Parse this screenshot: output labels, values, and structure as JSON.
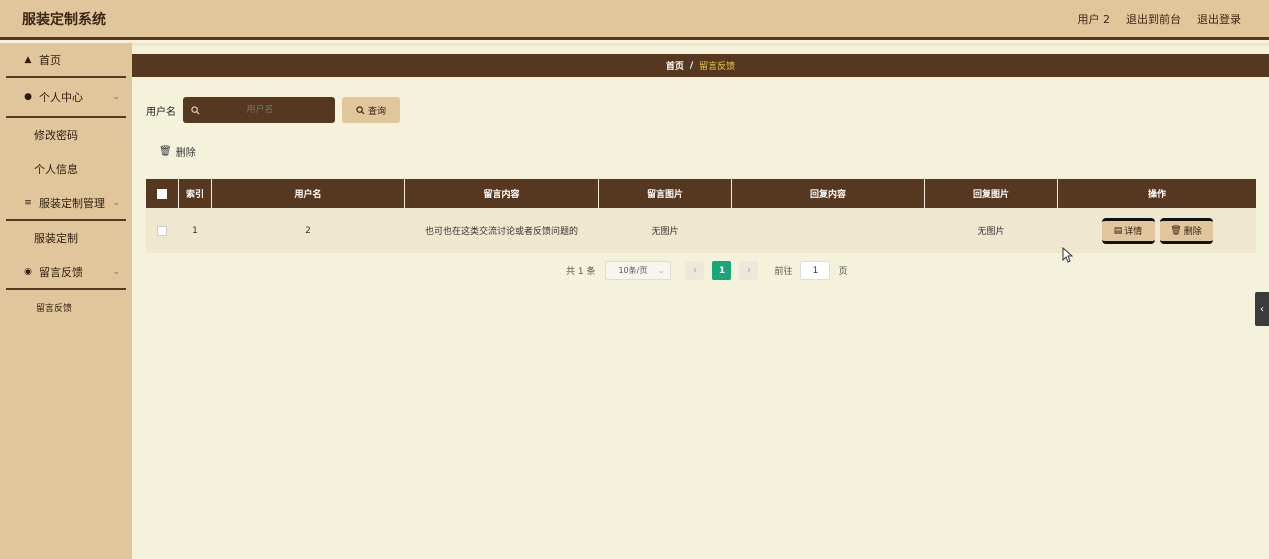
{
  "app": {
    "title": "服装定制系统"
  },
  "header": {
    "user": "用户 2",
    "front": "退出到前台",
    "logout": "退出登录"
  },
  "sidebar": {
    "home": "首页",
    "personal": "个人中心",
    "change_password": "修改密码",
    "profile": "个人信息",
    "custom_mgmt": "服装定制管理",
    "custom": "服装定制",
    "feedback": "留言反馈",
    "feedback_sub": "留言反馈"
  },
  "breadcrumb": {
    "home": "首页",
    "sep": "/",
    "current": "留言反馈"
  },
  "search": {
    "label": "用户名",
    "placeholder": "用户名",
    "button": "查询"
  },
  "actions": {
    "delete": "删除"
  },
  "table": {
    "headers": [
      "索引",
      "用户名",
      "留言内容",
      "留言图片",
      "回复内容",
      "回复图片",
      "操作"
    ],
    "rows": [
      {
        "index": "1",
        "username": "2",
        "content": "也可也在这类交流讨论或者反馈问题的",
        "image": "无图片",
        "reply": "",
        "reply_image": "无图片",
        "detail": "详情",
        "delete": "删除"
      }
    ]
  },
  "pager": {
    "total": "共 1 条",
    "page_size": "10条/页",
    "current_page": "1",
    "goto_label": "前往",
    "goto_value": "1",
    "page_unit": "页"
  },
  "colors": {
    "brown": "#55381f",
    "tan": "#e2c69b",
    "bg": "#f5f2dc",
    "accent_green": "#1aa67a"
  }
}
